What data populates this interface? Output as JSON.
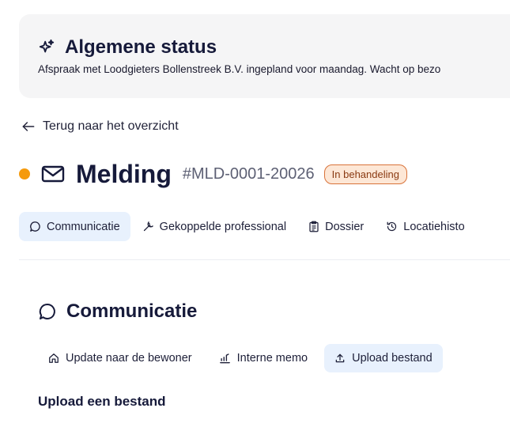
{
  "status": {
    "title": "Algemene status",
    "text": "Afspraak met Loodgieters Bollenstreek B.V. ingepland voor maandag. Wacht op bezo"
  },
  "back": {
    "label": "Terug naar het overzicht"
  },
  "header": {
    "title": "Melding",
    "reference": "#MLD-0001-20026",
    "badge": "In behandeling",
    "dot_color": "#f59a0c"
  },
  "tabs": [
    {
      "label": "Communicatie",
      "icon": "chat-bubble-icon",
      "active": true
    },
    {
      "label": "Gekoppelde professional",
      "icon": "wrench-icon",
      "active": false
    },
    {
      "label": "Dossier",
      "icon": "clipboard-icon",
      "active": false
    },
    {
      "label": "Locatiehisto",
      "icon": "history-icon",
      "active": false
    }
  ],
  "section": {
    "title": "Communicatie",
    "subtabs": [
      {
        "label": "Update naar de bewoner",
        "icon": "home-icon",
        "active": false
      },
      {
        "label": "Interne memo",
        "icon": "memo-icon",
        "active": false
      },
      {
        "label": "Upload bestand",
        "icon": "upload-icon",
        "active": true
      }
    ],
    "upload_heading": "Upload een bestand"
  },
  "colors": {
    "accent": "#e8f1fd",
    "badge_bg": "#fde7d6",
    "badge_border": "#d9733a",
    "title": "#161a3a"
  }
}
